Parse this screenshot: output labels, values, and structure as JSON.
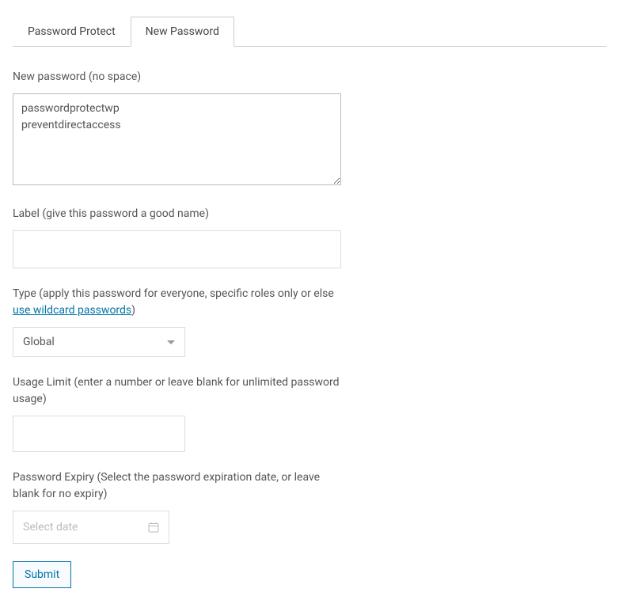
{
  "tabs": {
    "password_protect": "Password Protect",
    "new_password": "New Password"
  },
  "fields": {
    "new_password": {
      "label": "New password (no space)",
      "value": "passwordprotectwp\npreventdirectaccess"
    },
    "label_field": {
      "label": "Label (give this password a good name)",
      "value": ""
    },
    "type_field": {
      "label_prefix": "Type (apply this password for everyone, specific roles only or else ",
      "link_text": "use wildcard passwords",
      "label_suffix": ")",
      "selected": "Global"
    },
    "usage_limit": {
      "label": "Usage Limit (enter a number or leave blank for unlimited password usage)",
      "value": ""
    },
    "password_expiry": {
      "label": "Password Expiry (Select the password expiration date, or leave blank for no expiry)",
      "placeholder": "Select date"
    }
  },
  "buttons": {
    "submit": "Submit"
  }
}
